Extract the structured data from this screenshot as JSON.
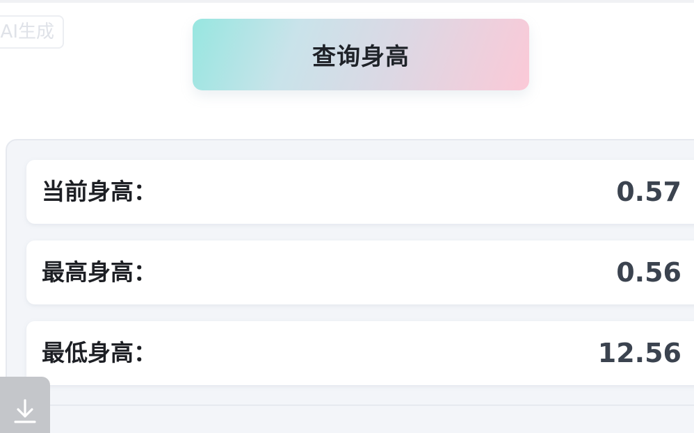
{
  "watermark": {
    "text": "AI生成"
  },
  "query_button": {
    "label": "查询身高"
  },
  "stats": [
    {
      "label": "当前身高：",
      "value": "0.57"
    },
    {
      "label": "最高身高：",
      "value": "0.56"
    },
    {
      "label": "最低身高：",
      "value": "12.56"
    }
  ],
  "icons": {
    "download": "download-icon"
  },
  "colors": {
    "button_gradient_start": "#97e6e0",
    "button_gradient_end": "#fbc9d7",
    "panel_background": "#f3f5f9",
    "value_text": "#3b434f"
  }
}
